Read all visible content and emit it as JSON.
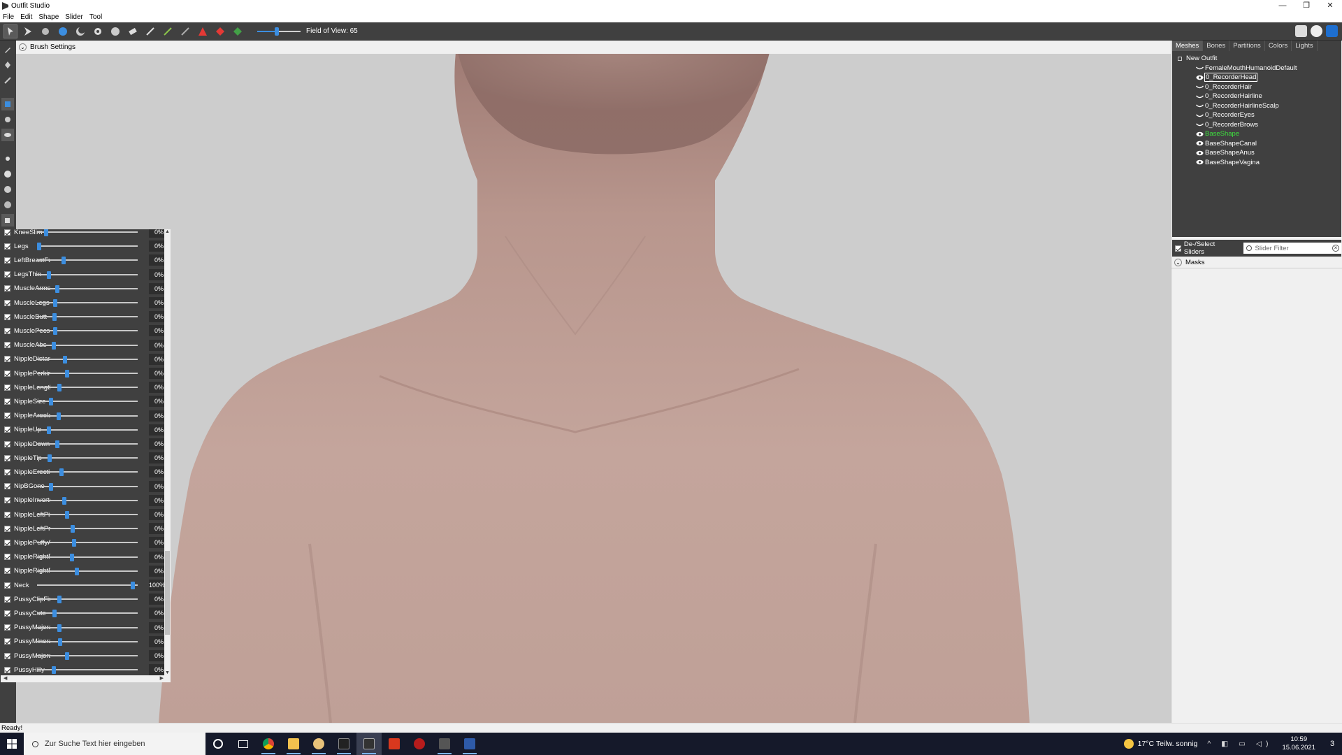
{
  "window": {
    "title": "Outfit Studio",
    "controls": [
      "—",
      "❐",
      "✕"
    ]
  },
  "menu": [
    "File",
    "Edit",
    "Shape",
    "Slider",
    "Tool"
  ],
  "toolbar": {
    "fov_label": "Field of View: 65",
    "fov_fraction": 0.45
  },
  "viewport": {
    "brush_settings_label": "Brush Settings"
  },
  "panel": {
    "tabs": [
      "Meshes",
      "Bones",
      "Partitions",
      "Colors",
      "Lights"
    ],
    "tree_root": "New Outfit",
    "meshes": [
      {
        "name": "FemaleMouthHumanoidDefault",
        "visible": false,
        "state": ""
      },
      {
        "name": "0_RecorderHead",
        "visible": true,
        "state": "selected"
      },
      {
        "name": "0_RecorderHair",
        "visible": false,
        "state": ""
      },
      {
        "name": "0_RecorderHairline",
        "visible": false,
        "state": ""
      },
      {
        "name": "0_RecorderHairlineScalp",
        "visible": false,
        "state": ""
      },
      {
        "name": "0_RecorderEyes",
        "visible": false,
        "state": ""
      },
      {
        "name": "0_RecorderBrows",
        "visible": false,
        "state": ""
      },
      {
        "name": "BaseShape",
        "visible": true,
        "state": "active"
      },
      {
        "name": "BaseShapeCanal",
        "visible": true,
        "state": ""
      },
      {
        "name": "BaseShapeAnus",
        "visible": true,
        "state": ""
      },
      {
        "name": "BaseShapeVagina",
        "visible": true,
        "state": ""
      }
    ],
    "deselect_label": "De-/Select Sliders",
    "filter_placeholder": "Slider Filter",
    "masks_label": "Masks",
    "sliders": [
      {
        "name": "KneeSlim",
        "pos": 0.07,
        "value": "0%"
      },
      {
        "name": "Legs",
        "pos": 0.0,
        "value": "0%"
      },
      {
        "name": "LeftBreastFuck",
        "pos": 0.25,
        "value": "0%"
      },
      {
        "name": "LegsThin",
        "pos": 0.1,
        "value": "0%"
      },
      {
        "name": "MuscleArms",
        "pos": 0.19,
        "value": "0%"
      },
      {
        "name": "MuscleLegs",
        "pos": 0.17,
        "value": "0%"
      },
      {
        "name": "MuscleButt",
        "pos": 0.16,
        "value": "0%"
      },
      {
        "name": "MusclePecs",
        "pos": 0.17,
        "value": "0%"
      },
      {
        "name": "MuscleAbs",
        "pos": 0.15,
        "value": "0%"
      },
      {
        "name": "NippleDistance",
        "pos": 0.27,
        "value": "0%"
      },
      {
        "name": "NipplePerkiness",
        "pos": 0.29,
        "value": "0%"
      },
      {
        "name": "NippleLength",
        "pos": 0.21,
        "value": "0%"
      },
      {
        "name": "NippleSize",
        "pos": 0.12,
        "value": "0%"
      },
      {
        "name": "NippleAreola",
        "pos": 0.2,
        "value": "0%"
      },
      {
        "name": "NippleUp",
        "pos": 0.1,
        "value": "0%"
      },
      {
        "name": "NippleDown",
        "pos": 0.19,
        "value": "0%"
      },
      {
        "name": "NippleTip",
        "pos": 0.11,
        "value": "0%"
      },
      {
        "name": "NippleErection",
        "pos": 0.23,
        "value": "0%"
      },
      {
        "name": "NipBGone",
        "pos": 0.12,
        "value": "0%"
      },
      {
        "name": "NippleInverted",
        "pos": 0.26,
        "value": "0%"
      },
      {
        "name": "NippleLeftPinch",
        "pos": 0.29,
        "value": "0%"
      },
      {
        "name": "NippleLeftPressed",
        "pos": 0.35,
        "value": "0%"
      },
      {
        "name": "NipplePuffyAreola",
        "pos": 0.36,
        "value": "0%"
      },
      {
        "name": "NippleRightPinch",
        "pos": 0.34,
        "value": "0%"
      },
      {
        "name": "NippleRightPressed",
        "pos": 0.39,
        "value": "0%"
      },
      {
        "name": "Neck",
        "pos": 0.97,
        "value": "100%"
      },
      {
        "name": "PussyClipFix",
        "pos": 0.21,
        "value": "0%"
      },
      {
        "name": "PussyCute",
        "pos": 0.16,
        "value": "0%"
      },
      {
        "name": "PussyMajora",
        "pos": 0.21,
        "value": "0%"
      },
      {
        "name": "PussyMinora",
        "pos": 0.22,
        "value": "0%"
      },
      {
        "name": "PussyMajoraBig",
        "pos": 0.29,
        "value": "0%"
      },
      {
        "name": "PussyHilly",
        "pos": 0.15,
        "value": "0%"
      }
    ]
  },
  "status": "Ready!",
  "taskbar": {
    "search_placeholder": "Zur Suche Text hier eingeben",
    "weather": "17°C  Teilw. sonnig",
    "time": "10:59",
    "date": "15.06.2021",
    "notif_count": "3"
  },
  "colors": {
    "accent": "#3c8ee0",
    "panel_dark": "#404040",
    "active_mesh": "#3ee03e"
  }
}
